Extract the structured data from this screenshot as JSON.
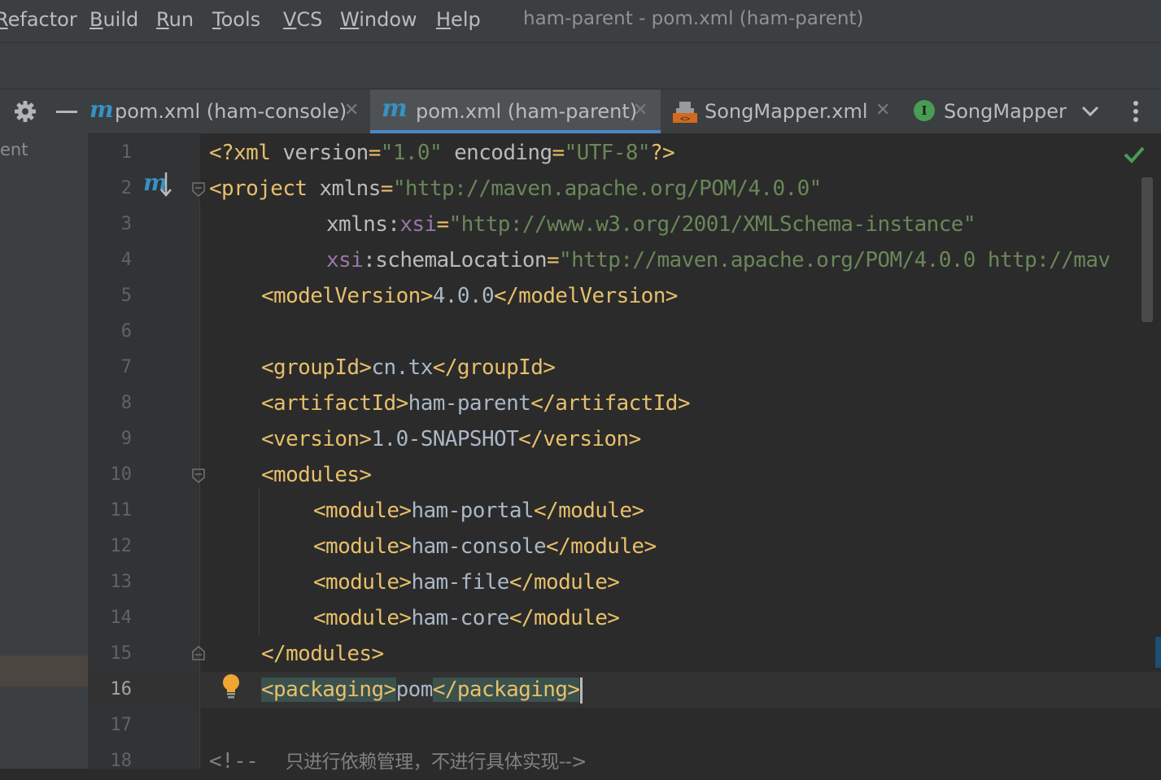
{
  "menu": {
    "items": [
      "Refactor",
      "Build",
      "Run",
      "Tools",
      "VCS",
      "Window",
      "Help"
    ],
    "window_title": "ham-parent - pom.xml (ham-parent)"
  },
  "project_panel": {
    "partial_label": "ent"
  },
  "tabs": [
    {
      "label": "pom.xml (ham-console)",
      "icon": "maven-icon",
      "active": false
    },
    {
      "label": "pom.xml (ham-parent)",
      "icon": "maven-icon",
      "active": true
    },
    {
      "label": "SongMapper.xml",
      "icon": "xml-file-icon",
      "active": false
    },
    {
      "label": "SongMapper",
      "icon": "interface-icon",
      "active": false
    }
  ],
  "tab_icon_letters": {
    "maven": "m",
    "interface": "I"
  },
  "editor": {
    "current_line": 16,
    "line_numbers": [
      "1",
      "2",
      "3",
      "4",
      "5",
      "6",
      "7",
      "8",
      "9",
      "10",
      "11",
      "12",
      "13",
      "14",
      "15",
      "16",
      "17",
      "18"
    ],
    "lines": {
      "l1": {
        "a": "<?xml ",
        "b": "version",
        "c": "=",
        "d": "\"1.0\"",
        "e": " ",
        "f": "encoding",
        "g": "=",
        "h": "\"UTF-8\"",
        "i": "?>"
      },
      "l2": {
        "a": "<project ",
        "b": "xmlns",
        "c": "=",
        "d": "\"http://maven.apache.org/POM/4.0.0\""
      },
      "l3": {
        "a": "xmlns",
        "b": ":",
        "c": "xsi",
        "d": "=",
        "e": "\"http://www.w3.org/2001/XMLSchema-instance\""
      },
      "l4": {
        "a": "xsi",
        "b": ":",
        "c": "schemaLocation",
        "d": "=",
        "e": "\"http://maven.apache.org/POM/4.0.0 http://mav"
      },
      "l5": {
        "a": "<modelVersion>",
        "b": "4.0.0",
        "c": "</modelVersion>"
      },
      "l7": {
        "a": "<groupId>",
        "b": "cn.tx",
        "c": "</groupId>"
      },
      "l8": {
        "a": "<artifactId>",
        "b": "ham-parent",
        "c": "</artifactId>"
      },
      "l9": {
        "a": "<version>",
        "b": "1.0-SNAPSHOT",
        "c": "</version>"
      },
      "l10": {
        "a": "<modules>"
      },
      "l11": {
        "a": "<module>",
        "b": "ham-portal",
        "c": "</module>"
      },
      "l12": {
        "a": "<module>",
        "b": "ham-console",
        "c": "</module>"
      },
      "l13": {
        "a": "<module>",
        "b": "ham-file",
        "c": "</module>"
      },
      "l14": {
        "a": "<module>",
        "b": "ham-core",
        "c": "</module>"
      },
      "l15": {
        "a": "</modules>"
      },
      "l16": {
        "a": "<packaging>",
        "b": "pom",
        "c": "</packaging>"
      },
      "l18": {
        "a": "<!--",
        "b": "     只进行依赖管理，不进行具体实现-->"
      }
    }
  },
  "colors": {
    "tag": "#e8bf6a",
    "attr_value": "#6a8759",
    "namespace": "#9876aa",
    "text": "#a9b7c6",
    "comment": "#808080",
    "accent": "#4a88c7",
    "ok": "#499c54"
  }
}
